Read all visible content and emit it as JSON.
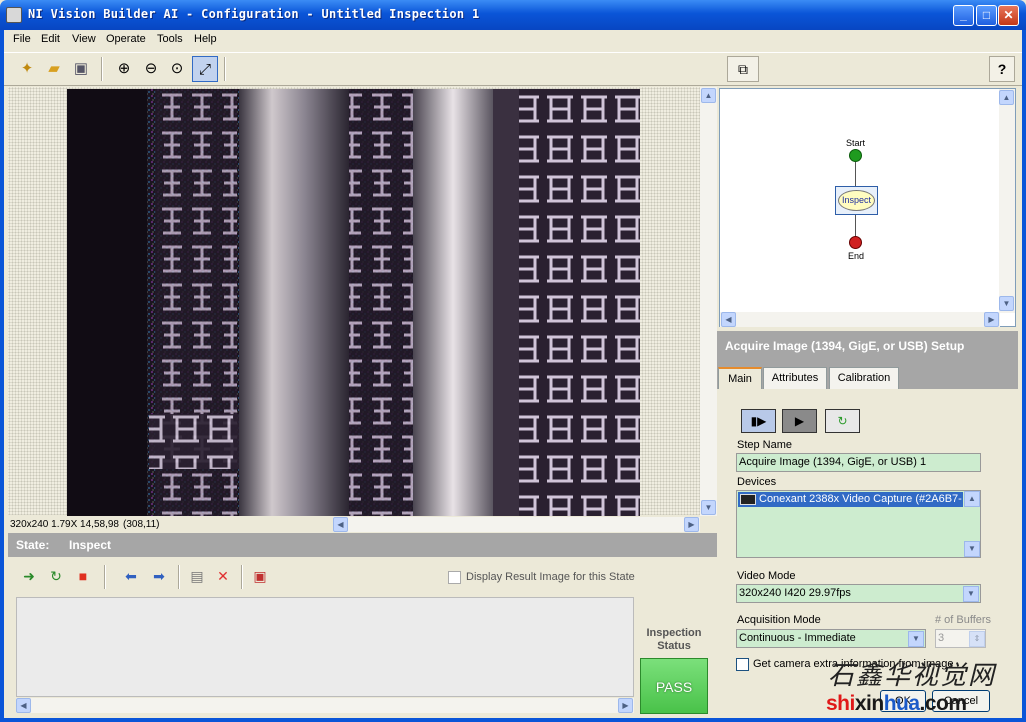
{
  "window": {
    "title": "NI Vision Builder AI - Configuration - Untitled Inspection 1",
    "minimize_glyph": "_",
    "maximize_glyph": "□",
    "close_glyph": "✕"
  },
  "menu": [
    "File",
    "Edit",
    "View",
    "Operate",
    "Tools",
    "Help"
  ],
  "toolbar": {
    "icons": [
      "new-icon",
      "open-icon",
      "save-icon",
      "zoom-in-icon",
      "zoom-out-icon",
      "zoom-actual-icon",
      "zoom-fit-icon"
    ]
  },
  "image_view": {
    "info": "320x240 1.79X 14,58,98",
    "coordinates": "(308,11)"
  },
  "state": {
    "label": "State:",
    "value": "Inspect",
    "display_result_label": "Display Result Image for this State",
    "display_result_checked": false
  },
  "inspection_status": {
    "label": "Inspection Status",
    "value": "PASS",
    "color": "#49c249"
  },
  "flowchart": {
    "start_label": "Start",
    "node_label": "Inspect",
    "end_label": "End"
  },
  "setup": {
    "title": "Acquire Image (1394, GigE, or USB) Setup",
    "tabs": [
      "Main",
      "Attributes",
      "Calibration"
    ],
    "active_tab": "Main",
    "step_name_label": "Step Name",
    "step_name_value": "Acquire Image (1394, GigE, or USB) 1",
    "devices_label": "Devices",
    "device_selected": "Conexant 2388x Video Capture  (#2A6B7-",
    "video_mode_label": "Video Mode",
    "video_mode_value": "320x240 I420 29.97fps",
    "acquisition_mode_label": "Acquisition Mode",
    "acquisition_mode_value": "Continuous - Immediate",
    "buffers_label": "# of Buffers",
    "buffers_value": "3",
    "get_info_label": "Get camera extra information from image",
    "get_info_checked": false,
    "ok_label": "OK",
    "cancel_label": "Cancel"
  },
  "watermark": {
    "text_cn": "石鑫华视觉网",
    "site": "shixinhua.com"
  },
  "colors": {
    "titlebar": "#0a55d8",
    "field_green": "#cdeccf",
    "selection": "#316ac5",
    "panel_gray": "#a6a6a6"
  }
}
